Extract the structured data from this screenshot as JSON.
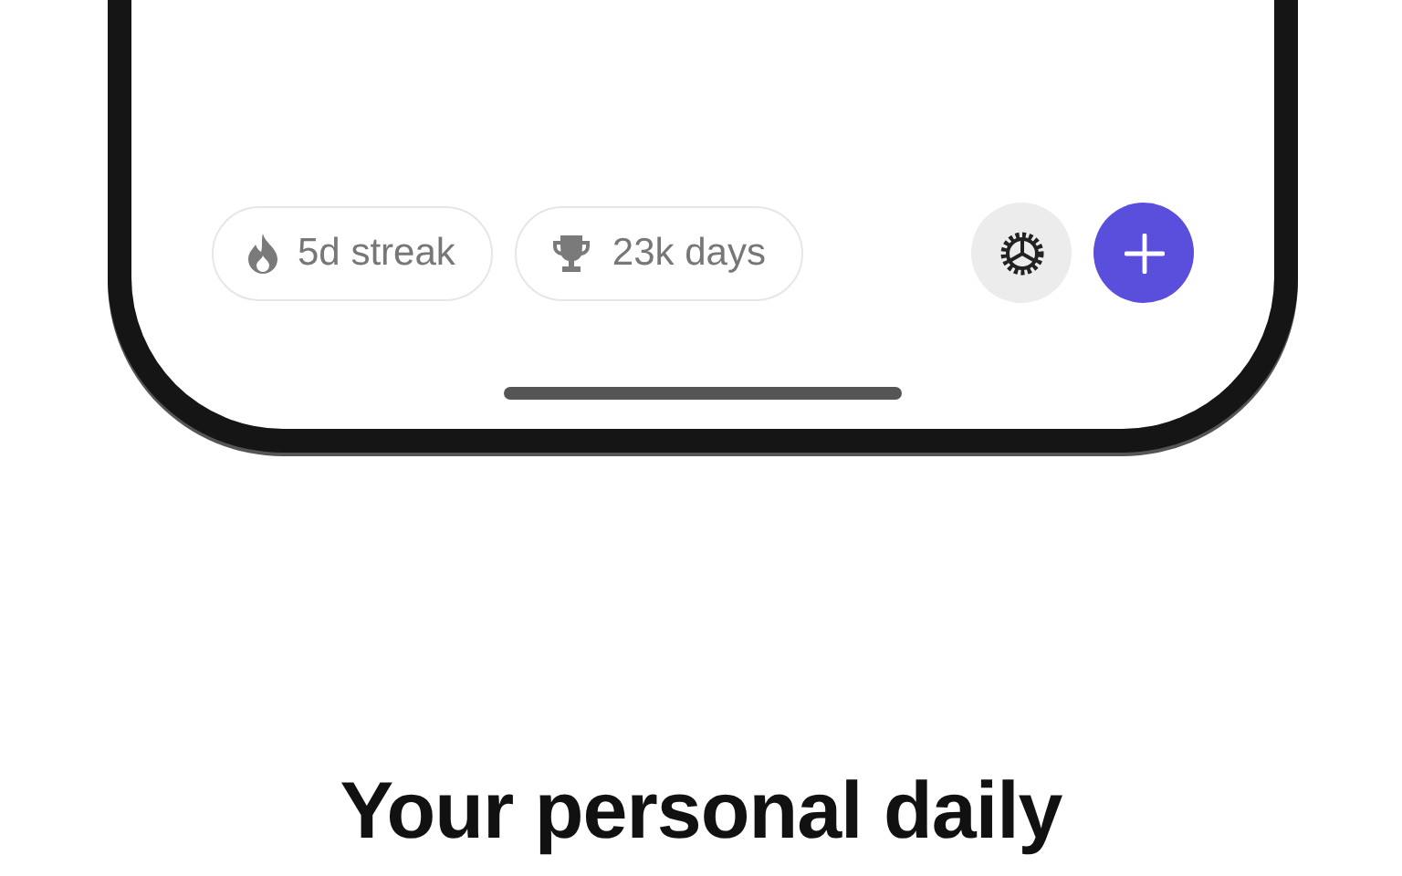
{
  "stats": [
    {
      "kind": "streak",
      "label": "5d streak"
    },
    {
      "kind": "trophy",
      "label": "23k days"
    }
  ],
  "heading": "Your personal daily"
}
